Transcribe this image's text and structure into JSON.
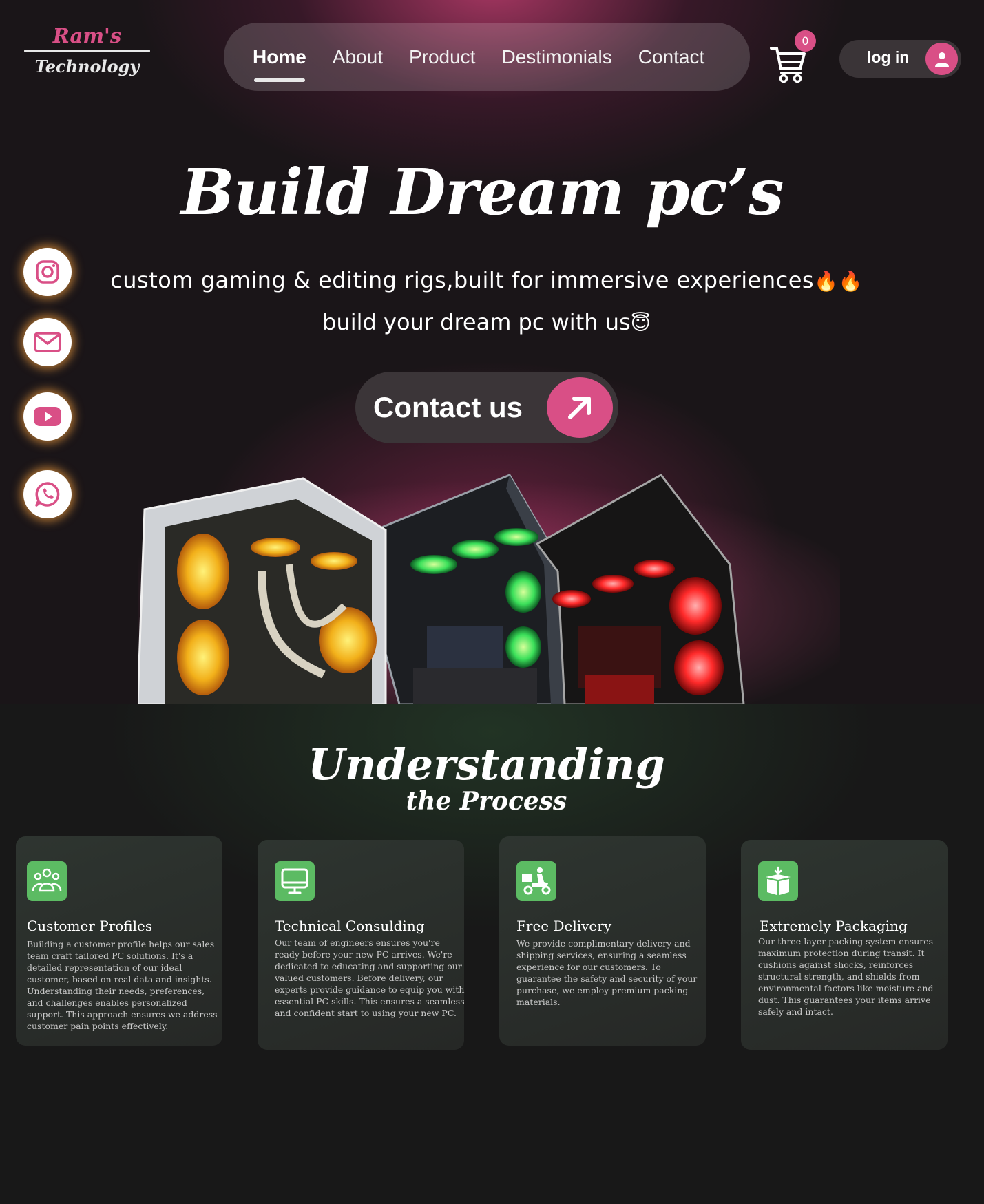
{
  "logo": {
    "top": "Ram's",
    "bottom": "Technology"
  },
  "nav": {
    "items": [
      {
        "label": "Home",
        "active": true
      },
      {
        "label": "About"
      },
      {
        "label": "Product"
      },
      {
        "label": "Destimonials"
      },
      {
        "label": "Contact"
      }
    ]
  },
  "cart": {
    "icon": "cart-icon",
    "count": "0"
  },
  "login": {
    "label": "log in",
    "icon": "user-icon"
  },
  "social": [
    {
      "name": "instagram-icon"
    },
    {
      "name": "mail-icon"
    },
    {
      "name": "youtube-icon"
    },
    {
      "name": "whatsapp-icon"
    }
  ],
  "hero": {
    "title": "Build Dream pc’s",
    "subtitle": "custom gaming & editing rigs,built for immersive experiences",
    "subtitle_emoji": "🔥🔥",
    "subtitle2": "build your dream pc with us",
    "subtitle2_emoji": "😇",
    "cta_label": "Contact us",
    "cta_icon": "arrow-up-right-icon"
  },
  "process": {
    "title": "Understanding",
    "subtitle": "the Process",
    "cards": [
      {
        "icon": "users-icon",
        "title": "Customer Profiles",
        "text": "Building a customer profile helps our sales team craft tailored PC solutions. It's a detailed representation of our ideal customer, based on real data and insights. Understanding their needs, preferences, and challenges enables personalized support. This approach ensures we address customer pain points effectively."
      },
      {
        "icon": "monitor-icon",
        "title": "Technical  Consulding",
        "text": "Our team of engineers ensures you're ready before your new PC arrives. We're dedicated to educating and supporting our valued customers. Before delivery, our experts provide guidance to equip you with essential PC skills. This ensures a seamless and confident start to using your new PC."
      },
      {
        "icon": "delivery-scooter-icon",
        "title": "Free Delivery",
        "text": "We provide complimentary delivery and shipping services, ensuring a seamless experience for our customers. To guarantee the safety and security of your purchase, we employ premium packing materials."
      },
      {
        "icon": "box-icon",
        "title": "Extremely Packaging",
        "text": "Our three-layer packing system ensures maximum protection during transit. It cushions against shocks, reinforces structural strength, and shields from environmental factors like moisture and dust. This guarantees your items arrive safely and intact."
      }
    ]
  },
  "colors": {
    "accent": "#d94f86",
    "green": "#5cbb63",
    "background": "#161616"
  }
}
